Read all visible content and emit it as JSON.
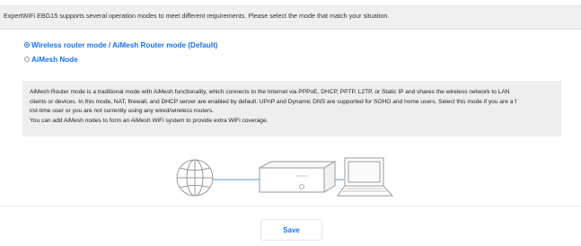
{
  "intro": {
    "text": "ExpertWiFi EBG15 supports several operation modes to meet different requirements. Please select the mode that match your situation."
  },
  "modes": [
    {
      "label": "Wireless router mode / AiMesh Router mode (Default)",
      "selected": true
    },
    {
      "label": "AiMesh Node",
      "selected": false
    }
  ],
  "description": {
    "lines": [
      "AiMesh Router mode is a traditional mode with AiMesh functionality, which connects to the Internet via PPPoE, DHCP, PPTP, L2TP, or Static IP and shares the wireless network to LAN",
      "clients or devices. In this mode, NAT, firewall, and DHCP server are enabled by default. UPnP and Dynamic DNS are supported for SOHO and home users. Select this mode if you are a f",
      "irst-time user or you are not currently using any wired/wireless routers.",
      "You can add AiMesh nodes to form an AiMesh WiFi system to provide extra WiFi coverage."
    ]
  },
  "diagram": {
    "icons": [
      "globe-icon",
      "router-icon",
      "laptop-icon"
    ],
    "line_color": "#5b9bd5"
  },
  "save": {
    "label": "Save"
  },
  "colors": {
    "accent": "#1a73e8",
    "panel": "#eeeeee"
  }
}
